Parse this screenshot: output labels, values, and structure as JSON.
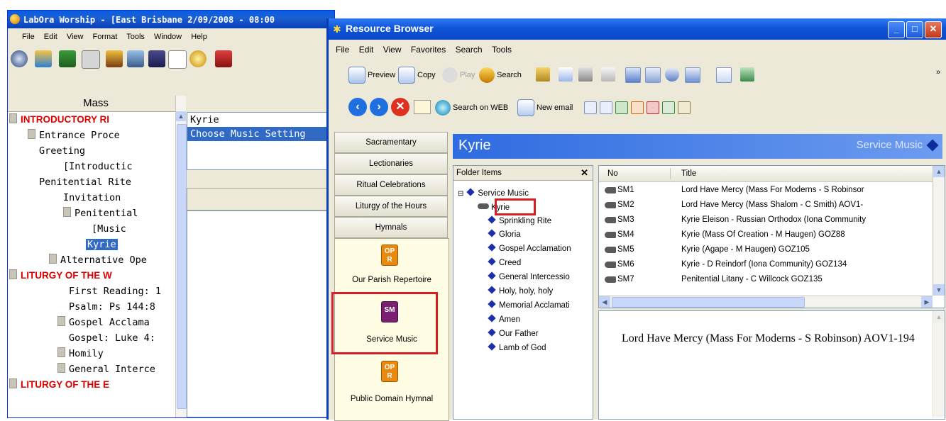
{
  "bg_app": {
    "title": "LabOra Worship - [East Brisbane 2/09/2008 - 08:00",
    "menu": [
      "File",
      "Edit",
      "View",
      "Format",
      "Tools",
      "Window",
      "Help"
    ],
    "tree_header": "Mass",
    "tree": [
      {
        "label": "INTRODUCTORY RI",
        "red": true
      },
      {
        "label": "Entrance Proce"
      },
      {
        "label": "Greeting"
      },
      {
        "label": "[Introductic"
      },
      {
        "label": "Penitential Rite"
      },
      {
        "label": "Invitation"
      },
      {
        "label": "Penitential"
      },
      {
        "label": "[Music"
      },
      {
        "label": "Kyrie",
        "selected": true
      },
      {
        "label": "Alternative Ope"
      },
      {
        "label": "LITURGY OF THE W",
        "red": true
      },
      {
        "label": "First Reading: 1"
      },
      {
        "label": "Psalm: Ps 144:8"
      },
      {
        "label": "Gospel Acclama"
      },
      {
        "label": "Gospel: Luke 4:"
      },
      {
        "label": "Homily"
      },
      {
        "label": "General Interce"
      },
      {
        "label": "LITURGY OF THE E",
        "red": true
      }
    ],
    "mid_list": [
      "Kyrie",
      "Choose Music Setting"
    ]
  },
  "rb": {
    "title": "Resource Browser",
    "menu": [
      "File",
      "Edit",
      "View",
      "Favorites",
      "Search",
      "Tools"
    ],
    "toolbar1": {
      "preview": "Preview",
      "copy": "Copy",
      "play": "Play",
      "search": "Search"
    },
    "toolbar2": {
      "search_web": "Search on WEB",
      "new_email": "New email"
    },
    "nav_buttons": [
      "Sacramentary",
      "Lectionaries",
      "Ritual Celebrations",
      "Liturgy of the Hours",
      "Hymnals"
    ],
    "books": [
      {
        "label": "Our Parish Repertoire",
        "badge": "OP R"
      },
      {
        "label": "Service Music",
        "badge": "SM"
      },
      {
        "label": "Public Domain Hymnal",
        "badge": "OP R"
      }
    ],
    "content_title": "Kyrie",
    "content_category": "Service Music",
    "folder": {
      "header": "Folder Items",
      "close": "✕",
      "root": "Service Music",
      "items": [
        "Kyrie",
        "Sprinkling Rite",
        "Gloria",
        "Gospel Acclamation",
        "Creed",
        "General Intercessio",
        "Holy, holy, holy",
        "Memorial Acclamati",
        "Amen",
        "Our Father",
        "Lamb of God"
      ]
    },
    "list": {
      "headers": {
        "no": "No",
        "title": "Title"
      },
      "rows": [
        {
          "no": "SM1",
          "title": "Lord Have Mercy (Mass For Moderns - S Robinsor"
        },
        {
          "no": "SM2",
          "title": "Lord Have Mercy (Mass Shalom - C Smith) AOV1-"
        },
        {
          "no": "SM3",
          "title": "Kyrie Eleison - Russian Orthodox (Iona Community"
        },
        {
          "no": "SM4",
          "title": "Kyrie (Mass Of Creation - M Haugen)  GOZ88"
        },
        {
          "no": "SM5",
          "title": "Kyrie (Agape - M Haugen)  GOZ105"
        },
        {
          "no": "SM6",
          "title": "Kyrie - D Reindorf (Iona Community)  GOZ134"
        },
        {
          "no": "SM7",
          "title": "Penitential Litany - C Willcock  GOZ135"
        }
      ]
    },
    "preview_text": "Lord Have Mercy (Mass For Moderns - S Robinson) AOV1-194"
  },
  "colors": {
    "accent": "#316ac5",
    "highlight": "#d51f24",
    "tree_red": "#e00000"
  }
}
